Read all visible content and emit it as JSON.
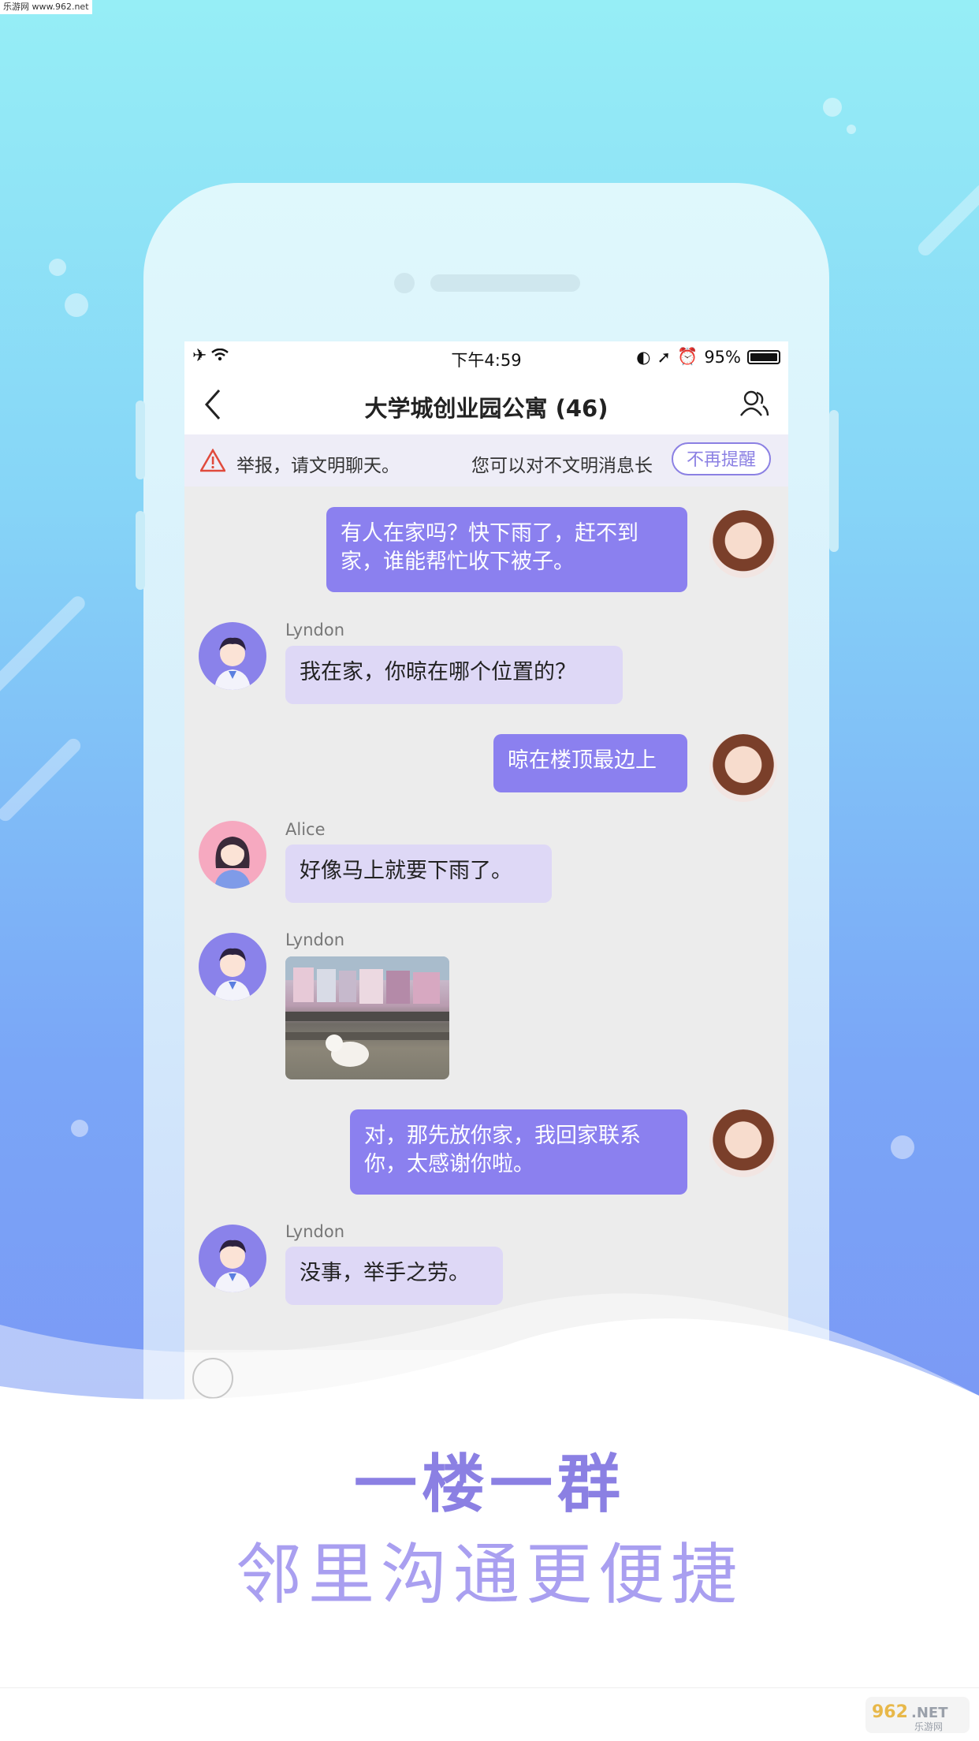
{
  "watermark_top": "乐游网 www.962.net",
  "status_bar": {
    "time": "下午4:59",
    "battery": "95%"
  },
  "chat": {
    "title": "大学城创业园公寓 (46)",
    "notice_left": "举报，请文明聊天。",
    "notice_right": "您可以对不文明消息长",
    "notice_button": "不再提醒",
    "messages": [
      {
        "dir": "out",
        "text": "有人在家吗？快下雨了，赶不到家，谁能帮忙收下被子。"
      },
      {
        "dir": "in",
        "sender": "Lyndon",
        "text": "我在家，你晾在哪个位置的？"
      },
      {
        "dir": "out",
        "text": "晾在楼顶最边上"
      },
      {
        "dir": "in",
        "sender": "Alice",
        "text": "好像马上就要下雨了。"
      },
      {
        "dir": "in",
        "sender": "Lyndon",
        "text": ""
      },
      {
        "dir": "out",
        "text": "对，那先放你家，我回家联系你，太感谢你啦。"
      },
      {
        "dir": "in",
        "sender": "Lyndon",
        "text": "没事，举手之劳。"
      }
    ]
  },
  "headline": "一楼一群",
  "subline": "邻里沟通更便捷",
  "colors": {
    "accent": "#8b80ef",
    "bubble_in": "#ded8f6",
    "bg_top": "#96eef6",
    "bg_bottom": "#7b99f5"
  },
  "icons": [
    "airplane-icon",
    "wifi-icon",
    "orientation-lock-icon",
    "location-icon",
    "alarm-icon",
    "battery-icon",
    "back-chevron-icon",
    "members-icon",
    "warning-icon",
    "voice-icon"
  ],
  "logo_text": "962.NET 乐游网"
}
